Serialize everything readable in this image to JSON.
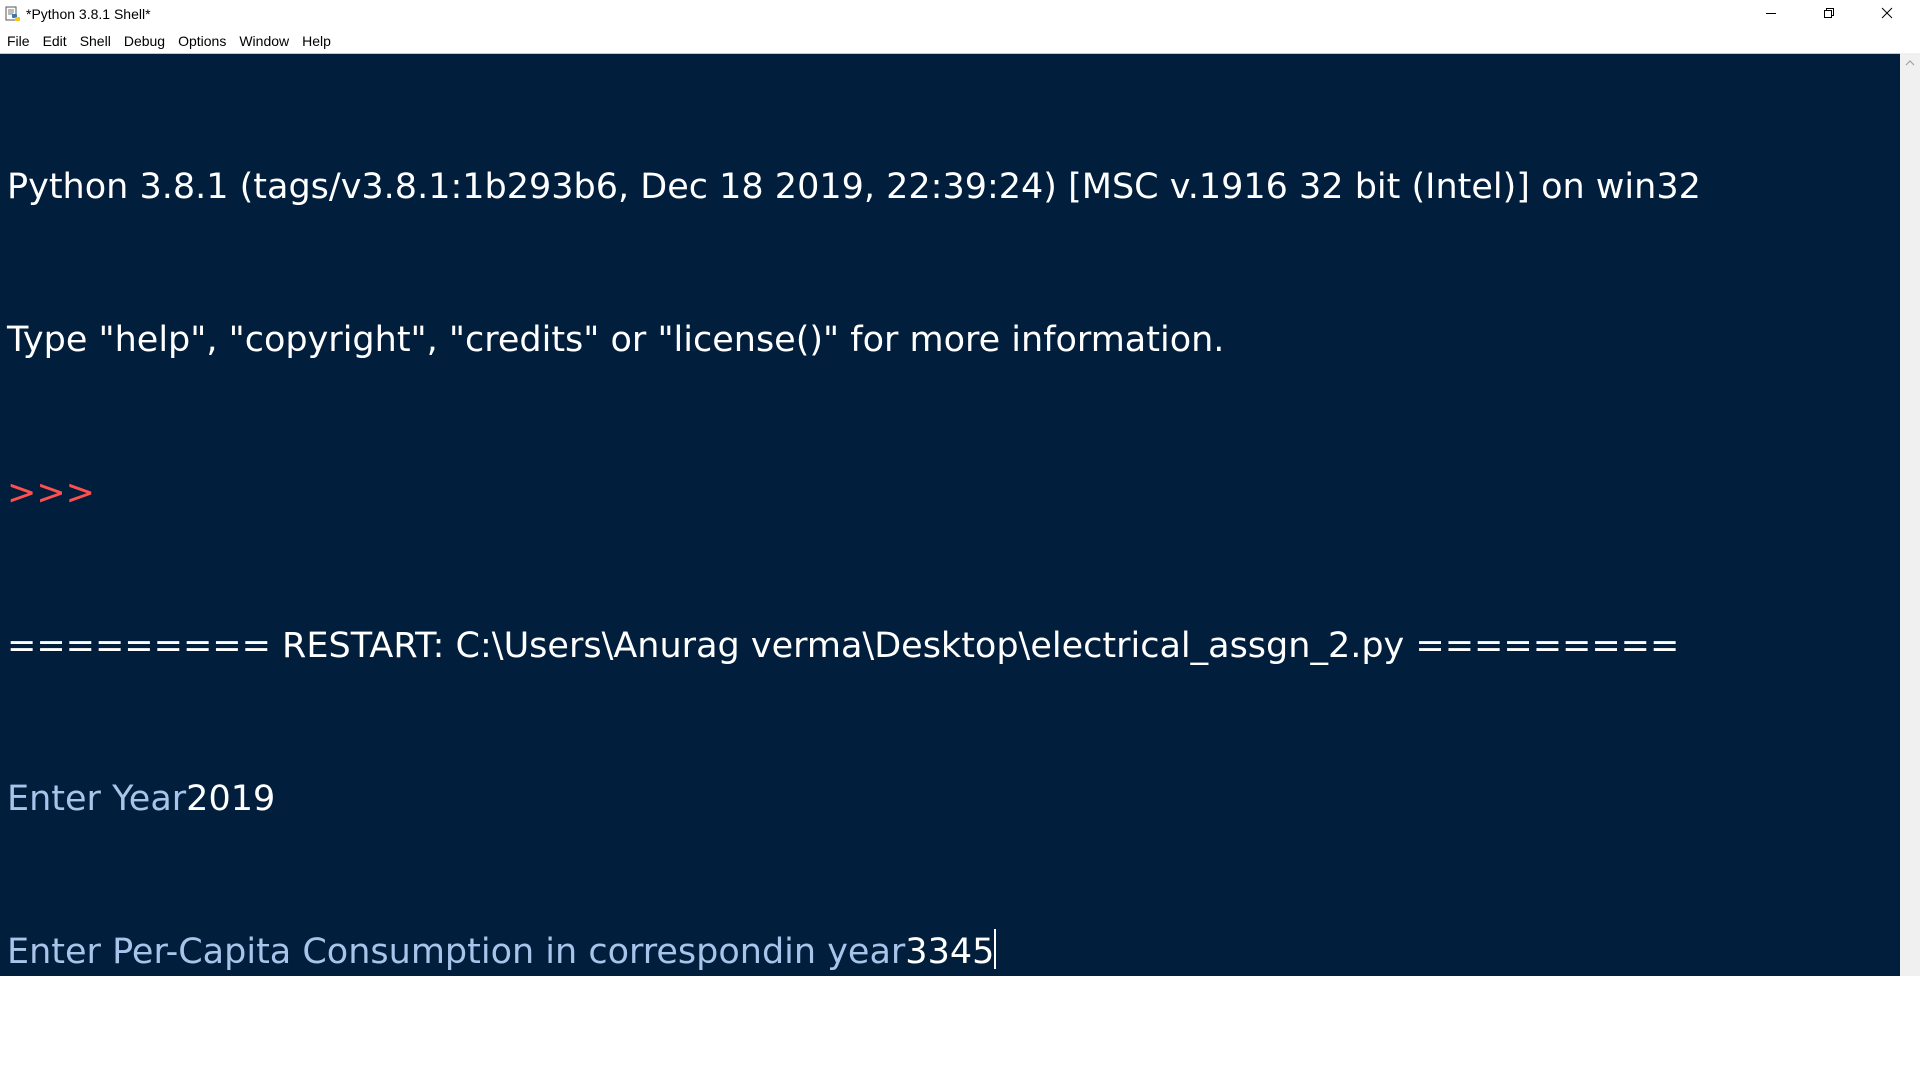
{
  "window": {
    "title": "*Python 3.8.1 Shell*",
    "icon": "idle-python-icon"
  },
  "window_controls": {
    "minimize_icon": "minimize-icon",
    "maximize_icon": "restore-icon",
    "close_icon": "close-icon"
  },
  "menu": {
    "items": [
      {
        "label": "File"
      },
      {
        "label": "Edit"
      },
      {
        "label": "Shell"
      },
      {
        "label": "Debug"
      },
      {
        "label": "Options"
      },
      {
        "label": "Window"
      },
      {
        "label": "Help"
      }
    ]
  },
  "shell": {
    "banner_line1": "Python 3.8.1 (tags/v3.8.1:1b293b6, Dec 18 2019, 22:39:24) [MSC v.1916 32 bit (Intel)] on win32",
    "banner_line2": "Type \"help\", \"copyright\", \"credits\" or \"license()\" for more information.",
    "prompt": ">>> ",
    "restart_line": "========= RESTART: C:\\Users\\Anurag verma\\Desktop\\electrical_assgn_2.py =========",
    "input1_prompt": "Enter Year",
    "input1_value": "2019",
    "input2_prompt": "Enter Per-Capita Consumption in correspondin year",
    "input2_value": "3345"
  },
  "colors": {
    "background": "#011e3c",
    "text": "#ffffff",
    "prompt": "#ff5050",
    "stdout": "#a9c4ea"
  }
}
